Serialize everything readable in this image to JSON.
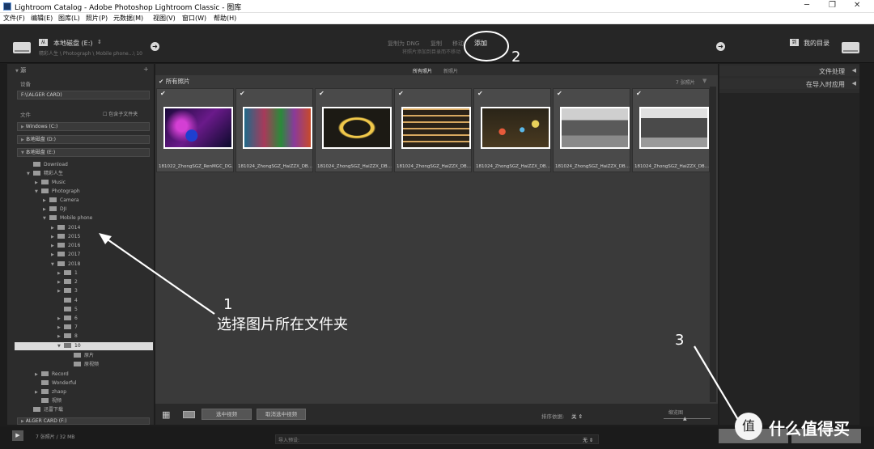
{
  "window": {
    "title": "Lightroom Catalog - Adobe Photoshop Lightroom Classic - 图库"
  },
  "menu": [
    "文件(F)",
    "编辑(E)",
    "图库(L)",
    "照片(P)",
    "元数据(M)",
    "视图(V)",
    "窗口(W)",
    "帮助(H)"
  ],
  "header": {
    "source_drive": "本地磁盘 (E:)",
    "source_path": "精彩人生 \\ Photograph \\ Mobile phone...\\ 10",
    "modes": [
      "复制为 DNG",
      "复制",
      "移动",
      "添加"
    ],
    "mode_selected": "添加",
    "mode_desc": "将照片添加到目录而不移动",
    "dest": "我的目录"
  },
  "source_panel": {
    "title": "源",
    "devices_label": "设备",
    "device": "F:\\(ALGER CARD)",
    "files_label": "文件",
    "include_subfolders": "包含子文件夹",
    "volumes": [
      "Windows (C:)",
      "本地磁盘 (D:)",
      "本地磁盘 (E:)"
    ],
    "tree": [
      "Download",
      "精彩人生",
      "Music",
      "Photograph",
      "Camera",
      "DJI",
      "Mobile phone",
      "2014",
      "2015",
      "2016",
      "2017",
      "2018",
      "1",
      "2",
      "3",
      "4",
      "5",
      "6",
      "7",
      "8",
      "9",
      "10",
      "原片",
      "原视频",
      "Record",
      "Wonderful",
      "zhaop",
      "视频",
      "迅雷下载"
    ],
    "card": "ALGER CARD (F:)"
  },
  "grid": {
    "tabs": [
      "所有照片",
      "新照片"
    ],
    "section": "所有照片",
    "count": "7 张照片",
    "photos": [
      {
        "name": "181022_ZhongSGZ_RenMGC_DG...",
        "color": "#5a2a8a"
      },
      {
        "name": "181024_ZhongSGZ_HaiZZX_DB...",
        "color": "#3a6a4a"
      },
      {
        "name": "181024_ZhongSGZ_HaiZZX_DB...",
        "color": "#2a2a20"
      },
      {
        "name": "181024_ZhongSGZ_HaiZZX_DB...",
        "color": "#6a5a3a"
      },
      {
        "name": "181024_ZhongSGZ_HaiZZX_DB...",
        "color": "#3a3020"
      },
      {
        "name": "181024_ZhongSGZ_HaiZZX_DB...",
        "color": "#7a7a7a"
      },
      {
        "name": "181024_ZhongSGZ_HaiZZX_DB...",
        "color": "#6a6a6a"
      }
    ]
  },
  "toolbar": {
    "check_all": "选中视频",
    "uncheck_all": "取消选中视频",
    "sort_label": "排序依据:",
    "sort_value": "关",
    "thumb_label": "缩览图"
  },
  "right_panel": {
    "file_handling": "文件处理",
    "apply_during_import": "在导入时应用"
  },
  "bottom": {
    "status": "7 张照片 / 32 MB",
    "preset_label": "导入预设:",
    "preset_value": "无"
  },
  "annotations": {
    "n1": "1",
    "t1": "选择图片所在文件夹",
    "n2": "2",
    "n3": "3"
  },
  "watermark": "值 什么值得买"
}
